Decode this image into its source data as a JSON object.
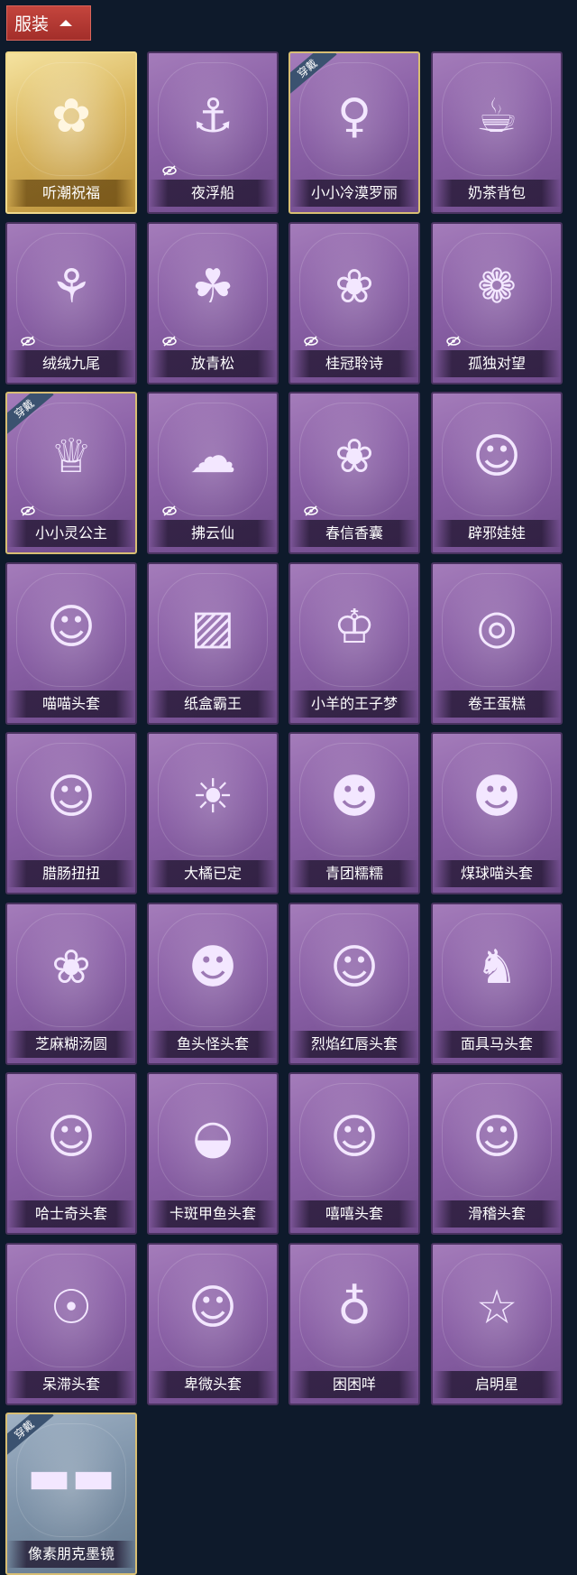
{
  "header": {
    "label": "服装"
  },
  "colors": {
    "accent": "#b8372f",
    "background": "#0e1a2b",
    "card": "#8a60a6",
    "gold": "#d9b65e"
  },
  "items": [
    {
      "name": "听潮祝福",
      "style": "gold",
      "badge": "",
      "hidden_icon": false,
      "art": "✿"
    },
    {
      "name": "夜浮船",
      "style": "purple",
      "badge": "",
      "hidden_icon": true,
      "art": "⚓"
    },
    {
      "name": "小小冷漠罗丽",
      "style": "equipped",
      "badge": "穿戴",
      "hidden_icon": false,
      "art": "♀"
    },
    {
      "name": "奶茶背包",
      "style": "purple",
      "badge": "",
      "hidden_icon": false,
      "art": "☕"
    },
    {
      "name": "绒绒九尾",
      "style": "purple",
      "badge": "",
      "hidden_icon": true,
      "art": "⚘"
    },
    {
      "name": "放青松",
      "style": "purple",
      "badge": "",
      "hidden_icon": true,
      "art": "☘"
    },
    {
      "name": "桂冠聆诗",
      "style": "purple",
      "badge": "",
      "hidden_icon": true,
      "art": "❀"
    },
    {
      "name": "孤独对望",
      "style": "purple",
      "badge": "",
      "hidden_icon": true,
      "art": "❁"
    },
    {
      "name": "小小灵公主",
      "style": "equipped",
      "badge": "穿戴",
      "hidden_icon": true,
      "art": "♕"
    },
    {
      "name": "拂云仙",
      "style": "purple",
      "badge": "",
      "hidden_icon": true,
      "art": "☁"
    },
    {
      "name": "春信香囊",
      "style": "purple",
      "badge": "",
      "hidden_icon": true,
      "art": "❀"
    },
    {
      "name": "辟邪娃娃",
      "style": "purple",
      "badge": "",
      "hidden_icon": false,
      "art": "☺"
    },
    {
      "name": "喵喵头套",
      "style": "purple",
      "badge": "",
      "hidden_icon": false,
      "art": "☺"
    },
    {
      "name": "纸盒霸王",
      "style": "purple",
      "badge": "",
      "hidden_icon": false,
      "art": "▨"
    },
    {
      "name": "小羊的王子梦",
      "style": "purple",
      "badge": "",
      "hidden_icon": false,
      "art": "♔"
    },
    {
      "name": "卷王蛋糕",
      "style": "purple",
      "badge": "",
      "hidden_icon": false,
      "art": "◎"
    },
    {
      "name": "腊肠扭扭",
      "style": "purple",
      "badge": "",
      "hidden_icon": false,
      "art": "☺"
    },
    {
      "name": "大橘已定",
      "style": "purple",
      "badge": "",
      "hidden_icon": false,
      "art": "☀"
    },
    {
      "name": "青团糯糯",
      "style": "purple",
      "badge": "",
      "hidden_icon": false,
      "art": "☻"
    },
    {
      "name": "煤球喵头套",
      "style": "purple",
      "badge": "",
      "hidden_icon": false,
      "art": "☻"
    },
    {
      "name": "芝麻糊汤圆",
      "style": "purple",
      "badge": "",
      "hidden_icon": false,
      "art": "❀"
    },
    {
      "name": "鱼头怪头套",
      "style": "purple",
      "badge": "",
      "hidden_icon": false,
      "art": "☻"
    },
    {
      "name": "烈焰红唇头套",
      "style": "purple",
      "badge": "",
      "hidden_icon": false,
      "art": "☺"
    },
    {
      "name": "面具马头套",
      "style": "purple",
      "badge": "",
      "hidden_icon": false,
      "art": "♞"
    },
    {
      "name": "哈士奇头套",
      "style": "purple",
      "badge": "",
      "hidden_icon": false,
      "art": "☺"
    },
    {
      "name": "卡斑甲鱼头套",
      "style": "purple",
      "badge": "",
      "hidden_icon": false,
      "art": "◒"
    },
    {
      "name": "嘻嘻头套",
      "style": "purple",
      "badge": "",
      "hidden_icon": false,
      "art": "☺"
    },
    {
      "name": "滑稽头套",
      "style": "purple",
      "badge": "",
      "hidden_icon": false,
      "art": "☺"
    },
    {
      "name": "呆滞头套",
      "style": "purple",
      "badge": "",
      "hidden_icon": false,
      "art": "☉"
    },
    {
      "name": "卑微头套",
      "style": "purple",
      "badge": "",
      "hidden_icon": false,
      "art": "☺"
    },
    {
      "name": "困困咩",
      "style": "purple",
      "badge": "",
      "hidden_icon": false,
      "art": "♁"
    },
    {
      "name": "启明星",
      "style": "purple",
      "badge": "",
      "hidden_icon": false,
      "art": "☆"
    },
    {
      "name": "像素朋克墨镜",
      "style": "blue",
      "badge": "穿戴",
      "hidden_icon": false,
      "art": "▬▬"
    }
  ]
}
